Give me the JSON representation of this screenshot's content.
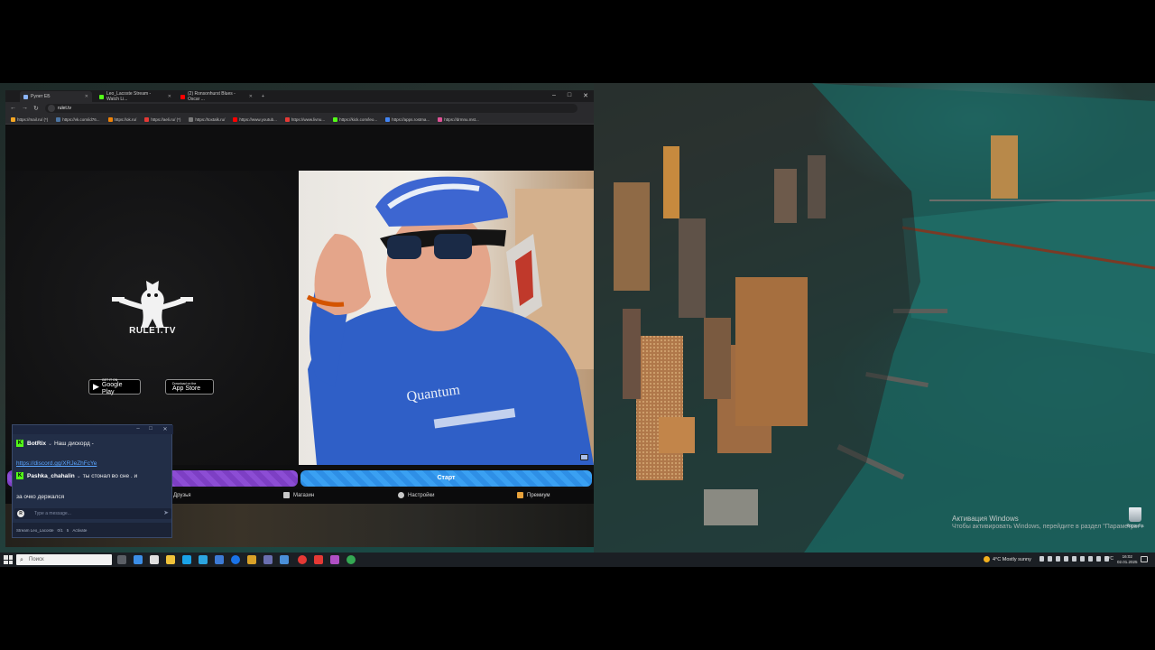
{
  "browser": {
    "tabs": [
      {
        "label": "Рулет ЕБ",
        "color": "#8ab4f8"
      },
      {
        "label": "Leo_Lacoste Stream - Watch Li...",
        "color": "#53fc18"
      },
      {
        "label": "(2) Ronsonhurst Blues - Oscar ...",
        "color": "#ff0000"
      }
    ],
    "new_tab": "+",
    "window_controls": {
      "minimize": "–",
      "maximize": "□",
      "close": "✕"
    },
    "nav": {
      "back": "←",
      "forward": "→",
      "reload": "↻"
    },
    "address": "rulet.tv",
    "bookmarks": [
      {
        "label": "https://mail.ru/ (*)",
        "color": "#f5a623"
      },
      {
        "label": "https://vk.com/id76...",
        "color": "#4c75a3"
      },
      {
        "label": "https://ok.ru/",
        "color": "#ee8208"
      },
      {
        "label": "https://aeli.ru/ (*)",
        "color": "#e53935"
      },
      {
        "label": "https://toxtalk.ru/",
        "color": "#7b7b7b"
      },
      {
        "label": "https://www.youtub...",
        "color": "#ff0000"
      },
      {
        "label": "https://www.livnu...",
        "color": "#e53935"
      },
      {
        "label": "https://kick.com/leo...",
        "color": "#53fc18"
      },
      {
        "label": "https://apps.rostma...",
        "color": "#4285f4"
      },
      {
        "label": "https://drmnu.mst...",
        "color": "#e05297"
      }
    ]
  },
  "rulet": {
    "logo_text": "RULET.TV",
    "google_play": {
      "top": "GET IT ON",
      "name": "Google Play",
      "glyph": "▶"
    },
    "app_store": {
      "top": "Download on the",
      "name": "App Store",
      "glyph": ""
    },
    "start_button": "Старт",
    "nav": [
      {
        "label": "Друзья",
        "color": "#5b6fd6"
      },
      {
        "label": "Магазин",
        "color": "#c8c8c8"
      },
      {
        "label": "Настройки",
        "color": "#c8c8c8"
      },
      {
        "label": "Премиум",
        "color": "#e8a23b"
      }
    ]
  },
  "chat": {
    "controls": {
      "minimize": "–",
      "maximize": "□",
      "close": "✕"
    },
    "messages": [
      {
        "user": "BotRix",
        "text": "Наш дискорд -",
        "link": "https://discord.gg/XRJeZhFcYe"
      },
      {
        "user": "Pashka_chahalin",
        "text": "ты стонал во сне . и",
        "cont": "за очко держался"
      }
    ],
    "badge": "K",
    "input_avatar": "R",
    "input_placeholder": "Type a message...",
    "send": "➤",
    "footer": [
      "Stream Leo_Lacoste",
      "0/1",
      "5",
      "Activate"
    ]
  },
  "desktop": {
    "activation_title": "Активация Windows",
    "activation_text": "Чтобы активировать Windows, перейдите в раздел \"Параметры\".",
    "recycle_bin": "Корзина"
  },
  "taskbar": {
    "search_placeholder": "Поиск",
    "weather": "4°C  Mostly sunny",
    "language": "РУС",
    "time": "16:02",
    "date": "02.01.2025"
  }
}
